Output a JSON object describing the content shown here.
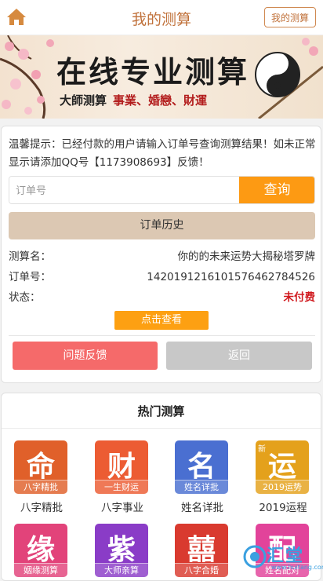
{
  "header": {
    "title": "我的测算",
    "my_button": "我的测算",
    "home_icon": "home-icon"
  },
  "banner": {
    "title": "在线专业测算",
    "subtitle_black": "大師测算",
    "subtitle_red": "事業、婚戀、財運",
    "icon": "yin-yang-icon"
  },
  "query": {
    "tip": "温馨提示：已经付款的用户请输入订单号查询测算结果！如未正常显示请添加QQ号【1173908693】反馈！",
    "input_placeholder": "订单号",
    "input_value": "",
    "search_button": "查询",
    "history_button": "订单历史",
    "fields": [
      {
        "label": "测算名：",
        "value": "你的的未来运势大揭秘塔罗牌"
      },
      {
        "label": "订单号：",
        "value": "14201912161015764627845​26"
      },
      {
        "label": "状态：",
        "value": "未付费"
      }
    ],
    "check_button": "点击查看",
    "feedback_button": "问题反馈",
    "back_button": "返回"
  },
  "hot": {
    "title": "热门测算",
    "items": [
      {
        "char": "命",
        "band": "八字精批",
        "label": "八字精批",
        "color": "#e0602a"
      },
      {
        "char": "财",
        "band": "一生财运",
        "label": "八字事业",
        "color": "#ec5c33"
      },
      {
        "char": "名",
        "band": "姓名详批",
        "label": "姓名详批",
        "color": "#4a6fd1"
      },
      {
        "char": "运",
        "band": "2019运势",
        "label": "2019运程",
        "color": "#e4a11c",
        "badge": "新"
      },
      {
        "char": "缘",
        "band": "姻缘测算",
        "label": "",
        "color": "#e2437a"
      },
      {
        "char": "紫",
        "band": "大师亲算",
        "label": "",
        "color": "#8a3cc7"
      },
      {
        "char": "囍",
        "band": "八字合婚",
        "label": "",
        "color": "#d93a2f"
      },
      {
        "char": "配",
        "band": "姓名配对",
        "label": "",
        "color": "#e2439a"
      }
    ]
  },
  "watermark": {
    "text": "汇堂",
    "url": "www.huitang.com"
  },
  "colors": {
    "accent": "#fd9a13",
    "brown": "#c0713a",
    "red": "#d0191e",
    "feedback": "#f56a6a"
  }
}
